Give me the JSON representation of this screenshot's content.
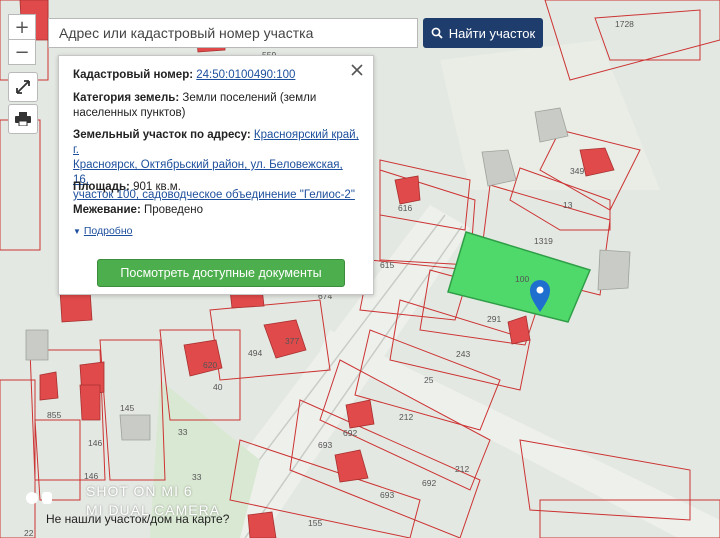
{
  "search": {
    "placeholder": "Адрес или кадастровый номер участка",
    "button_label": "Найти участок"
  },
  "zoom": {
    "in_label": "+",
    "out_label": "−"
  },
  "popup": {
    "cadastral_label": "Кадастровый номер:",
    "cadastral_value": "24:50:0100490:100",
    "category_label": "Категория земель:",
    "category_value_1": "Земли поселений (земли",
    "category_value_2": "населенных пунктов)",
    "address_label": "Земельный участок по адресу:",
    "address_first": "Красноярский край, г.",
    "address_line_2": "Красноярск, Октябрьский район, ул. Беловежская, 16,",
    "address_line_3": "участок 100, садоводческое объединение \"Гелиос-2\"",
    "area_label": "Площадь:",
    "area_value": "901 кв.м.",
    "survey_label": "Межевание:",
    "survey_value": "Проведено",
    "more_label": "Подробно",
    "docs_button": "Посмотреть доступные документы"
  },
  "map": {
    "not_found_text": "Не нашли участок/дом на карте?",
    "parcel_labels": [
      "1728",
      "559",
      "349",
      "13",
      "616",
      "1319",
      "615",
      "100",
      "674",
      "291",
      "243",
      "494",
      "377",
      "620",
      "40",
      "25",
      "212",
      "855",
      "145",
      "146",
      "33",
      "693",
      "692",
      "693",
      "692",
      "212",
      "146",
      "33",
      "155",
      "22"
    ],
    "selected_parcel_color": "#4fd96a",
    "parcel_border_color": "#cc3333",
    "building_color": "#e04a4a",
    "marker_color": "#1f6fcf"
  },
  "watermark": {
    "line1": "SHOT ON MI 6",
    "line2": "MI DUAL CAMERA"
  }
}
